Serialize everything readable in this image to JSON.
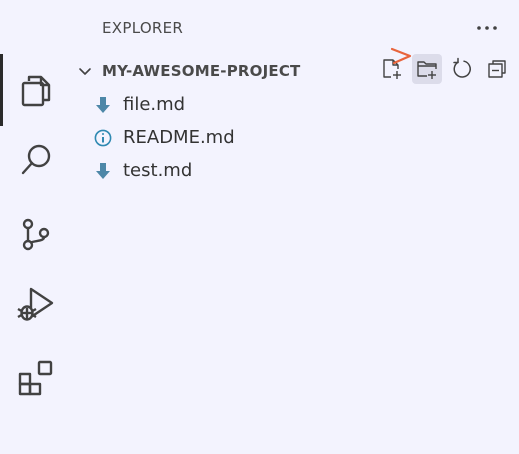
{
  "activity_bar": {
    "items": [
      {
        "name": "explorer",
        "icon": "files-icon",
        "active": true
      },
      {
        "name": "search",
        "icon": "search-icon",
        "active": false
      },
      {
        "name": "source-control",
        "icon": "source-control-icon",
        "active": false
      },
      {
        "name": "run-and-debug",
        "icon": "run-debug-icon",
        "active": false
      },
      {
        "name": "extensions",
        "icon": "extensions-icon",
        "active": false
      }
    ]
  },
  "sidebar": {
    "title": "EXPLORER",
    "more_actions_icon": "ellipsis-icon"
  },
  "project": {
    "name": "MY-AWESOME-PROJECT",
    "expanded": true,
    "actions": [
      {
        "name": "new-file",
        "icon": "new-file-icon"
      },
      {
        "name": "new-folder",
        "icon": "new-folder-icon",
        "hovered": true
      },
      {
        "name": "refresh",
        "icon": "refresh-icon"
      },
      {
        "name": "collapse-all",
        "icon": "collapse-all-icon"
      }
    ]
  },
  "files": [
    {
      "label": "file.md",
      "icon": "markdown-download-icon"
    },
    {
      "label": "README.md",
      "icon": "info-icon"
    },
    {
      "label": "test.md",
      "icon": "markdown-download-icon"
    }
  ],
  "colors": {
    "background": "#f3f3fe",
    "icon": "#424242",
    "markdown_icon": "#4d87a8",
    "info_icon": "#2f89b2",
    "pointer": "#e8643c",
    "hover": "#dcdcea"
  }
}
